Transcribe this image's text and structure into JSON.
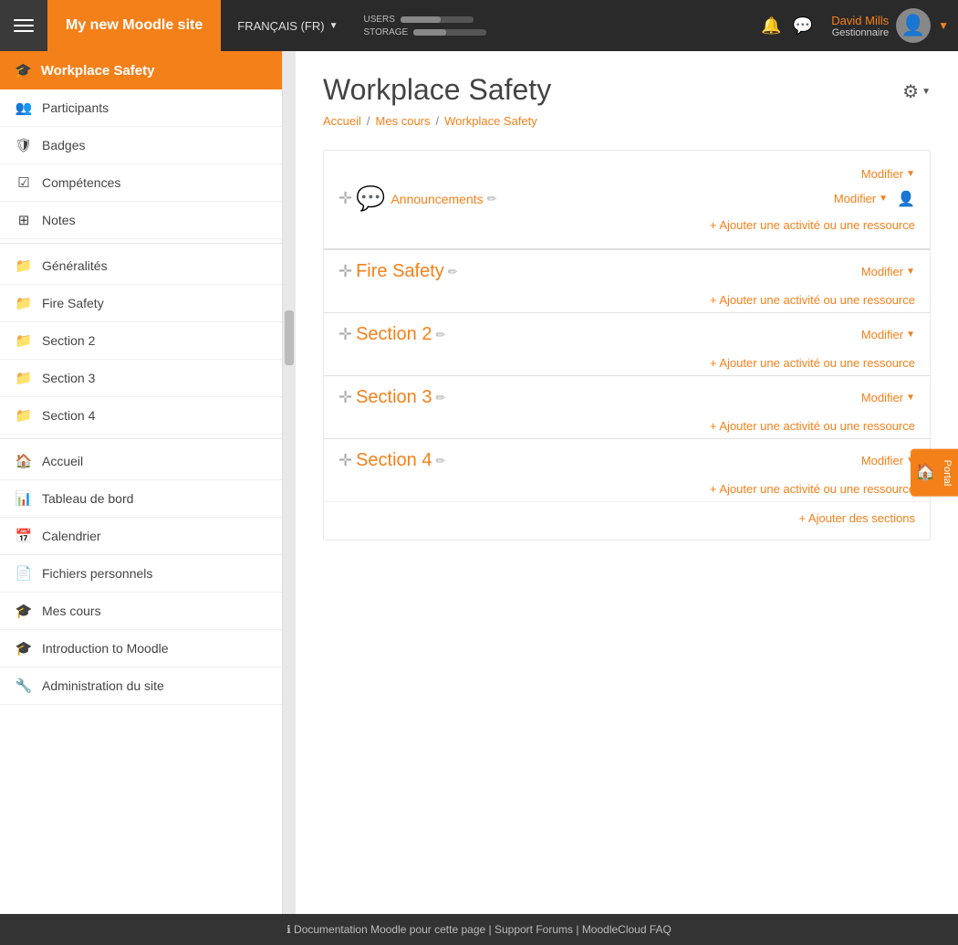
{
  "topnav": {
    "brand": "My new Moodle site",
    "lang": "FRANÇAIS (FR)",
    "storage_label": "USERS\nSTORAGE",
    "users_label": "USERS",
    "storage_label2": "STORAGE",
    "users_fill": "55",
    "storage_fill": "45",
    "user_name": "David Mills",
    "user_role": "Gestionnaire"
  },
  "sidebar": {
    "course_title": "Workplace Safety",
    "items": [
      {
        "id": "participants",
        "icon": "👥",
        "label": "Participants"
      },
      {
        "id": "badges",
        "icon": "🛡",
        "label": "Badges"
      },
      {
        "id": "competences",
        "icon": "☑",
        "label": "Compétences"
      },
      {
        "id": "notes",
        "icon": "⊞",
        "label": "Notes"
      },
      {
        "id": "generalites",
        "icon": "📁",
        "label": "Généralités"
      },
      {
        "id": "fire-safety",
        "icon": "📁",
        "label": "Fire Safety"
      },
      {
        "id": "section2",
        "icon": "📁",
        "label": "Section 2"
      },
      {
        "id": "section3",
        "icon": "📁",
        "label": "Section 3"
      },
      {
        "id": "section4",
        "icon": "📁",
        "label": "Section 4"
      },
      {
        "id": "accueil",
        "icon": "🏠",
        "label": "Accueil"
      },
      {
        "id": "tableau",
        "icon": "📊",
        "label": "Tableau de bord"
      },
      {
        "id": "calendrier",
        "icon": "📅",
        "label": "Calendrier"
      },
      {
        "id": "fichiers",
        "icon": "📄",
        "label": "Fichiers personnels"
      },
      {
        "id": "mes-cours",
        "icon": "🎓",
        "label": "Mes cours"
      },
      {
        "id": "intro-moodle",
        "icon": "🎓",
        "label": "Introduction to Moodle"
      },
      {
        "id": "admin",
        "icon": "🔧",
        "label": "Administration du site"
      }
    ]
  },
  "breadcrumb": {
    "accueil": "Accueil",
    "sep1": "/",
    "mes_cours": "Mes cours",
    "sep2": "/",
    "current": "Workplace Safety"
  },
  "page": {
    "title": "Workplace Safety",
    "gear_label": "⚙"
  },
  "general_section": {
    "modifier1": "Modifier",
    "modifier2": "Modifier",
    "announcements": "Announcements",
    "add_resource": "+ Ajouter une activité ou une ressource"
  },
  "sections": [
    {
      "title": "Fire Safety",
      "modifier": "Modifier",
      "add_resource": "+ Ajouter une activité ou une ressource"
    },
    {
      "title": "Section 2",
      "modifier": "Modifier",
      "add_resource": "+ Ajouter une activité ou une ressource"
    },
    {
      "title": "Section 3",
      "modifier": "Modifier",
      "add_resource": "+ Ajouter une activité ou une ressource"
    },
    {
      "title": "Section 4",
      "modifier": "Modifier",
      "add_resource": "+ Ajouter une activité ou une ressource"
    }
  ],
  "add_sections": "+ Ajouter des sections",
  "footer": {
    "text": "Documentation Moodle pour cette page | Support Forums | MoodleCloud FAQ"
  },
  "portal": "Portal"
}
